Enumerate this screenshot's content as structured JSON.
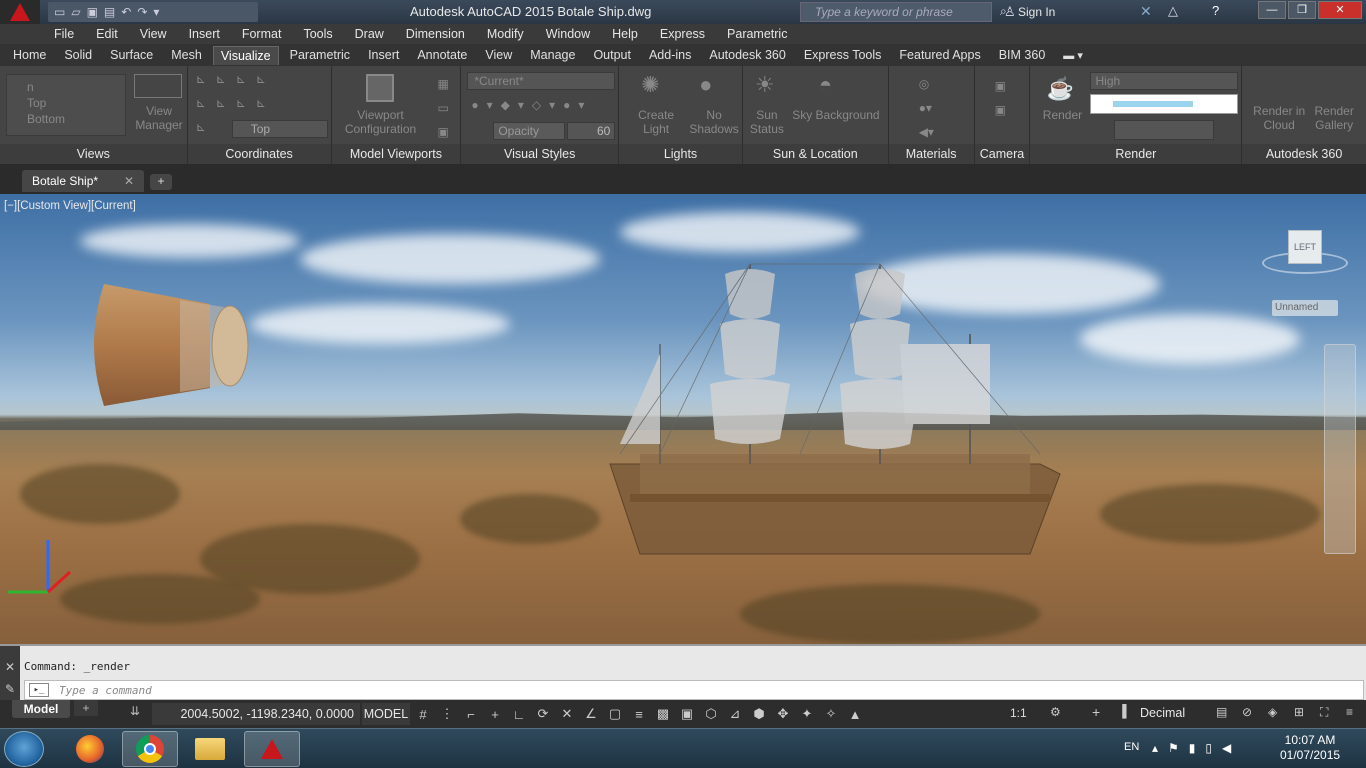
{
  "window": {
    "title": "Autodesk AutoCAD 2015    Botale Ship.dwg",
    "search_placeholder": "Type a keyword or phrase",
    "sign_in": "Sign In"
  },
  "menubar": [
    "File",
    "Edit",
    "View",
    "Insert",
    "Format",
    "Tools",
    "Draw",
    "Dimension",
    "Modify",
    "Window",
    "Help",
    "Express",
    "Parametric"
  ],
  "ribbon_tabs": [
    "Home",
    "Solid",
    "Surface",
    "Mesh",
    "Visualize",
    "Parametric",
    "Insert",
    "Annotate",
    "View",
    "Manage",
    "Output",
    "Add-ins",
    "Autodesk 360",
    "Express Tools",
    "Featured Apps",
    "BIM 360"
  ],
  "active_tab": "Visualize",
  "panels": {
    "views": {
      "title": "Views",
      "items": [
        "n",
        "Top",
        "Bottom"
      ],
      "view_manager": "View Manager"
    },
    "coordinates": {
      "title": "Coordinates",
      "ucs_value": "Top"
    },
    "model_viewports": {
      "title": "Model Viewports",
      "viewport_config": "Viewport Configuration"
    },
    "visual_styles": {
      "title": "Visual Styles",
      "current_style": "*Current*",
      "opacity_label": "Opacity",
      "opacity_value": "60"
    },
    "lights": {
      "title": "Lights",
      "create_light": "Create Light",
      "no_shadows": "No Shadows"
    },
    "sun_location": {
      "title": "Sun & Location",
      "sun_status": "Sun Status",
      "sky_background": "Sky Background"
    },
    "materials": {
      "title": "Materials"
    },
    "camera": {
      "title": "Camera"
    },
    "render": {
      "title": "Render",
      "render_label": "Render",
      "quality": "High"
    },
    "autodesk360": {
      "title": "Autodesk 360",
      "render_cloud": "Render in Cloud",
      "render_gallery": "Render Gallery"
    }
  },
  "doc_tab": "Botale Ship*",
  "viewport": {
    "label": "[−][Custom View][Current]",
    "viewcube_face": "LEFT",
    "named_view": "Unnamed"
  },
  "command": {
    "history": "Command: _render",
    "placeholder": "Type a command"
  },
  "status": {
    "model_tab": "Model",
    "coordinates": "2004.5002, -1198.2340, 0.0000",
    "model_button": "MODEL",
    "scale": "1:1",
    "units": "Decimal"
  },
  "taskbar": {
    "language": "EN",
    "time": "10:07 AM",
    "date": "01/07/2015"
  },
  "icons": [
    "autocad-logo-icon",
    "new-icon",
    "open-icon",
    "save-icon",
    "undo-icon",
    "redo-icon",
    "search-icon",
    "user-icon",
    "help-icon",
    "lightbulb-icon",
    "sun-icon",
    "camera-icon",
    "teapot-icon",
    "grid-icon",
    "snap-icon",
    "start-icon",
    "firefox-icon",
    "chrome-icon",
    "folder-icon"
  ],
  "colors": {
    "accent": "#c8161d",
    "ribbon": "#454545",
    "active_tab": "#4a4a4a"
  }
}
